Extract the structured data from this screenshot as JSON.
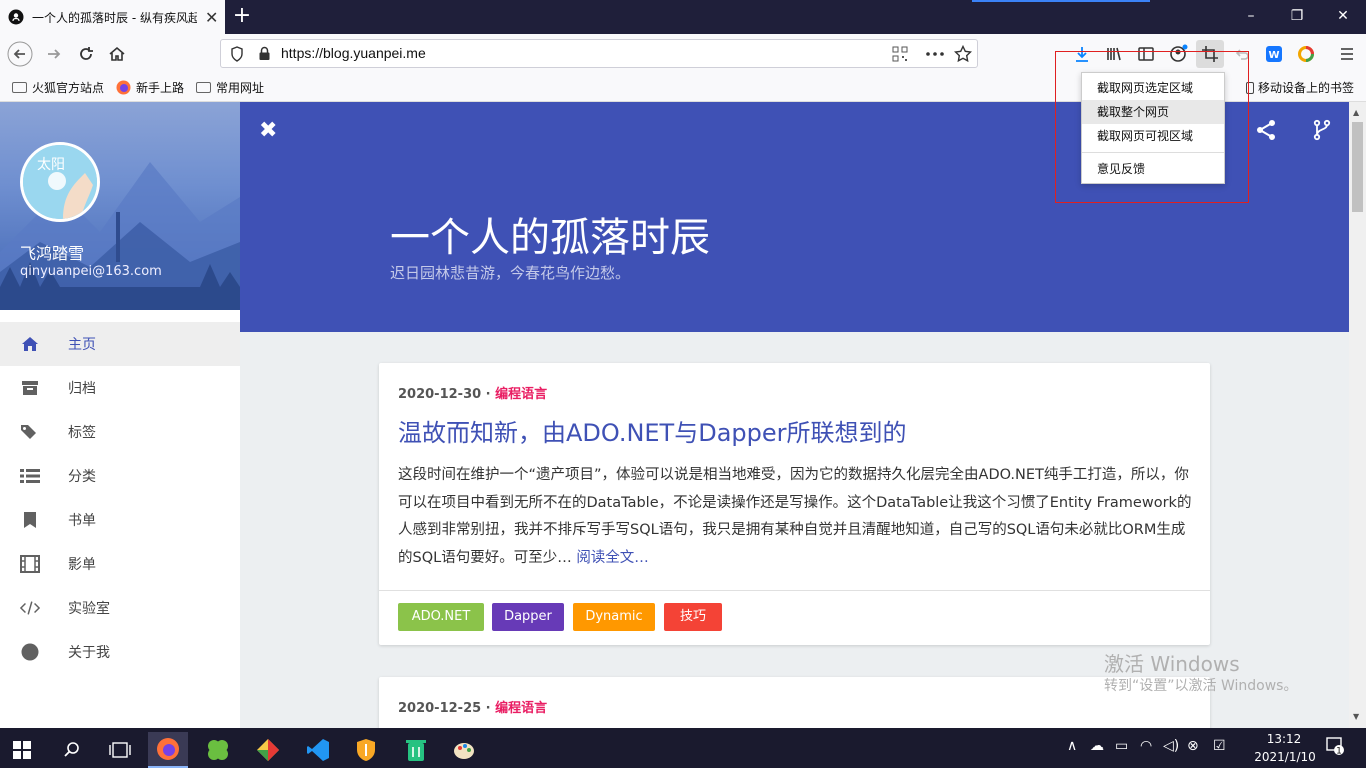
{
  "browser": {
    "tab_title": "一个人的孤落时辰 - 纵有疾风起",
    "url": "https://blog.yuanpei.me",
    "win_min": "–",
    "win_max": "❐",
    "win_close": "✕"
  },
  "bookmarks": [
    {
      "label": "火狐官方站点",
      "icon": "folder-icon"
    },
    {
      "label": "新手上路",
      "icon": "firefox-icon"
    },
    {
      "label": "常用网址",
      "icon": "folder-icon"
    }
  ],
  "mobile_bookmarks": "移动设备上的书签",
  "screenshot_menu": {
    "items": [
      "截取网页选定区域",
      "截取整个网页",
      "截取网页可视区域"
    ],
    "feedback": "意见反馈"
  },
  "sidebar": {
    "name": "飞鸿踏雪",
    "email": "qinyuanpei@163.com",
    "avatar_text": "太阳",
    "items": [
      {
        "label": "主页",
        "icon": "home-icon"
      },
      {
        "label": "归档",
        "icon": "archive-icon"
      },
      {
        "label": "标签",
        "icon": "tags-icon"
      },
      {
        "label": "分类",
        "icon": "list-icon"
      },
      {
        "label": "书单",
        "icon": "bookmark-icon"
      },
      {
        "label": "影单",
        "icon": "film-icon"
      },
      {
        "label": "实验室",
        "icon": "code-icon"
      },
      {
        "label": "关于我",
        "icon": "circle-icon"
      }
    ]
  },
  "hero": {
    "title": "一个人的孤落时辰",
    "subtitle": "迟日园林悲昔游，今春花鸟作边愁。"
  },
  "posts": [
    {
      "date": "2020-12-30",
      "category": "编程语言",
      "title": "温故而知新，由ADO.NET与Dapper所联想到的",
      "excerpt": "这段时间在维护一个“遗产项目”，体验可以说是相当地难受，因为它的数据持久化层完全由ADO.NET纯手工打造，所以，你可以在项目中看到无所不在的DataTable，不论是读操作还是写操作。这个DataTable让我这个习惯了Entity Framework的人感到非常别扭，我并不排斥写手写SQL语句，我只是拥有某种自觉并且清醒地知道，自己写的SQL语句未必就比ORM生成的SQL语句要好。可至少…",
      "read_more": "阅读全文…",
      "tags": [
        {
          "label": "ADO.NET",
          "color": "#8bc34a"
        },
        {
          "label": "Dapper",
          "color": "#673ab7"
        },
        {
          "label": "Dynamic",
          "color": "#ff9800"
        },
        {
          "label": "技巧",
          "color": "#f44336"
        }
      ]
    },
    {
      "date": "2020-12-25",
      "category": "编程语言"
    }
  ],
  "watermark": {
    "line1": "激活 Windows",
    "line2": "转到“设置”以激活 Windows。"
  },
  "taskbar": {
    "time": "13:12",
    "date": "2021/1/10",
    "notifications": "1"
  },
  "colors": {
    "accent": "#3f51b5",
    "category": "#e91e63"
  }
}
